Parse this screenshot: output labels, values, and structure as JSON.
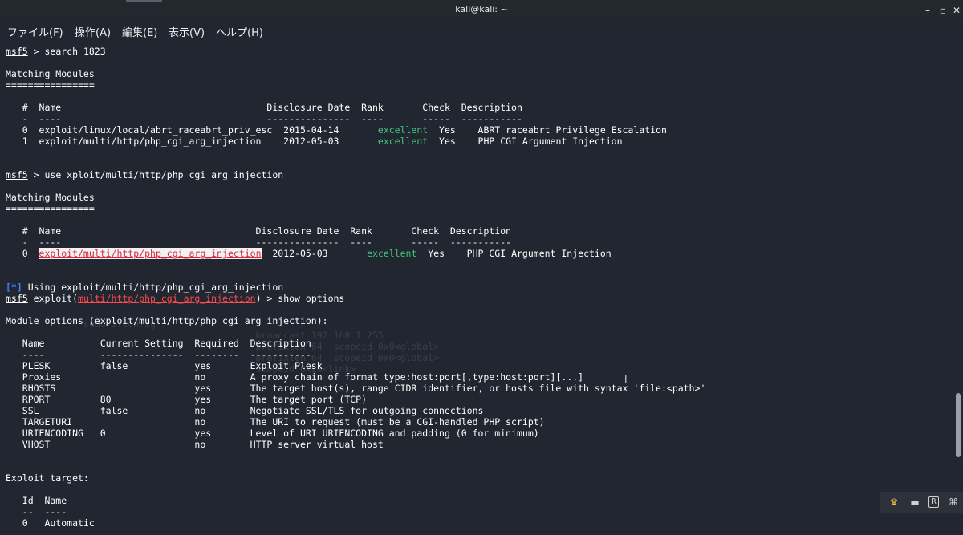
{
  "window": {
    "title": "kali@kali: ~"
  },
  "menu": {
    "file": "ファイル(F)",
    "edit_ops": "操作(A)",
    "edit": "編集(E)",
    "view": "表示(V)",
    "help": "ヘルプ(H)"
  },
  "term": {
    "prompt": "msf5",
    "cmd1": " > search 1823",
    "matching": "Matching Modules",
    "rule": "================",
    "t1": {
      "header": "   #  Name                                     Disclosure Date  Rank       Check  Description",
      "dashes": "   -  ----                                     ---------------  ----       -----  -----------",
      "r0_pre": "   0  exploit/linux/local/abrt_raceabrt_priv_esc  2015-04-14       ",
      "r0_rank": "excellent",
      "r0_post": "  Yes    ABRT raceabrt Privilege Escalation",
      "r1_pre": "   1  exploit/multi/http/php_cgi_arg_injection    2012-05-03       ",
      "r1_rank": "excellent",
      "r1_post": "  Yes    PHP CGI Argument Injection"
    },
    "cmd2": " > use xploit/multi/http/php_cgi_arg_injection",
    "t2": {
      "header": "   #  Name                                   Disclosure Date  Rank       Check  Description",
      "dashes": "   -  ----                                   ---------------  ----       -----  -----------",
      "r0_pre": "   0  ",
      "r0_name": "exploit/multi/http/php_cgi_arg_injection",
      "r0_mid": "  2012-05-03       ",
      "r0_rank": "excellent",
      "r0_post": "  Yes    PHP CGI Argument Injection"
    },
    "info_marker": "[*]",
    "info_text": " Using exploit/multi/http/php_cgi_arg_injection",
    "exploit_pre": " exploit(",
    "exploit_mod": "multi/http/php_cgi_arg_injection",
    "exploit_post": ") > show options",
    "module_opts": "Module options (exploit/multi/http/php_cgi_arg_injection):",
    "opts_header": "   Name          Current Setting  Required  Description",
    "opts_dashes": "   ----          ---------------  --------  -----------",
    "opts": [
      "   PLESK         false            yes       Exploit Plesk",
      "   Proxies                        no        A proxy chain of format type:host:port[,type:host:port][...]",
      "   RHOSTS                         yes       The target host(s), range CIDR identifier, or hosts file with syntax 'file:<path>'",
      "   RPORT         80               yes       The target port (TCP)",
      "   SSL           false            no        Negotiate SSL/TLS for outgoing connections",
      "   TARGETURI                      no        The URI to request (must be a CGI-handled PHP script)",
      "   URIENCODING   0                yes       Level of URI URIENCODING and padding (0 for minimum)",
      "   VHOST                          no        HTTP server virtual host"
    ],
    "exploit_target": "Exploit target:",
    "tgt_header": "   Id  Name",
    "tgt_dashes": "   --  ----",
    "tgt_row": "   0   Automatic"
  },
  "colors": {
    "background": "#212630",
    "rank_green": "#3fc87a",
    "module_red": "#ff4a4a",
    "info_blue": "#3d7eff"
  },
  "icons": [
    "minimize-icon",
    "maximize-icon",
    "close-icon",
    "crown-icon",
    "tray-minimize-icon",
    "r-icon",
    "gamepad-icon"
  ]
}
